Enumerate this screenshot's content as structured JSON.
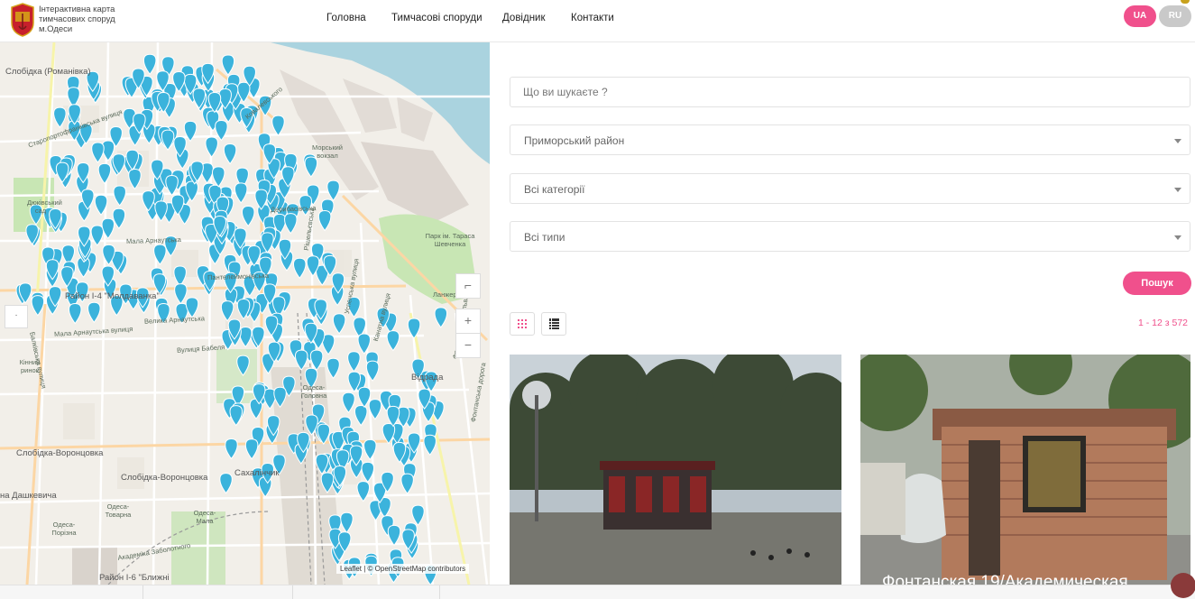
{
  "header": {
    "brand_lines": [
      "Інтерактивна карта",
      "тимчасових споруд",
      "м.Одеси"
    ],
    "nav": [
      "Головна",
      "Тимчасові споруди",
      "Довідник",
      "Контакти"
    ],
    "langs": [
      "UA",
      "RU"
    ],
    "accent": "#f0508c"
  },
  "map": {
    "labels": {
      "l1": "Слобідка (Романівка)",
      "l2": "Район І-4 \"Молдаванка\"",
      "l3": "Слобідка-Воронцовка",
      "l4": "Слобідка-Воронцовка",
      "l5": "Сахалінчик",
      "l6": "на Дашкевича",
      "l7": "Одеса-Товарна",
      "l8": "Одеса-Мала",
      "l9": "Одеса-Порізна",
      "l10": "Район І-6 \"Ближні",
      "l11": "Одеса-Головна",
      "l12": "Відрада",
      "l13": "Морський вокзал",
      "l14": "Парк ім. Тараса Шевченка",
      "l15": "Ланжерон",
      "l16": "Дюківський сад",
      "l17": "Мала Арнаутська вулиця",
      "l18": "Балківська вулиця",
      "l19": "Французький бульвар",
      "l20": "Успенська вулиця",
      "l21": "Старопортофранківська вулиця",
      "l22": "Фонтанська дорога",
      "l23": "Кінний ринок",
      "l24": "Вулиця Бабеля",
      "l25": "Мала Арнаутська",
      "l26": "Пантелеймонівська",
      "l27": "Дерибасівська",
      "l28": "Канатна вулиця",
      "l29": "Рішельєвська",
      "l30": "Велика Арнаутська",
      "l31": "Ковалевського",
      "l32": "Академіка Заболотного"
    },
    "zoom_in": "+",
    "zoom_out": "−",
    "fullscreen": "⌐",
    "locate": "·",
    "attribution_leaflet": "Leaflet",
    "attribution_sep": " | © ",
    "attribution_osm": "OpenStreetMap",
    "attribution_tail": " contributors",
    "pin_color": "#3bb3dc"
  },
  "search": {
    "placeholder": "Що ви шукаєте ?",
    "district": "Приморський район",
    "category": "Всі категорії",
    "type": "Всі типи",
    "button": "Пошук"
  },
  "results": {
    "count": "1 - 12 з 572",
    "view_grid_icon": "grid-icon",
    "view_list_icon": "list-icon",
    "card2_caption": "Фонтанская 19/Академическая"
  }
}
